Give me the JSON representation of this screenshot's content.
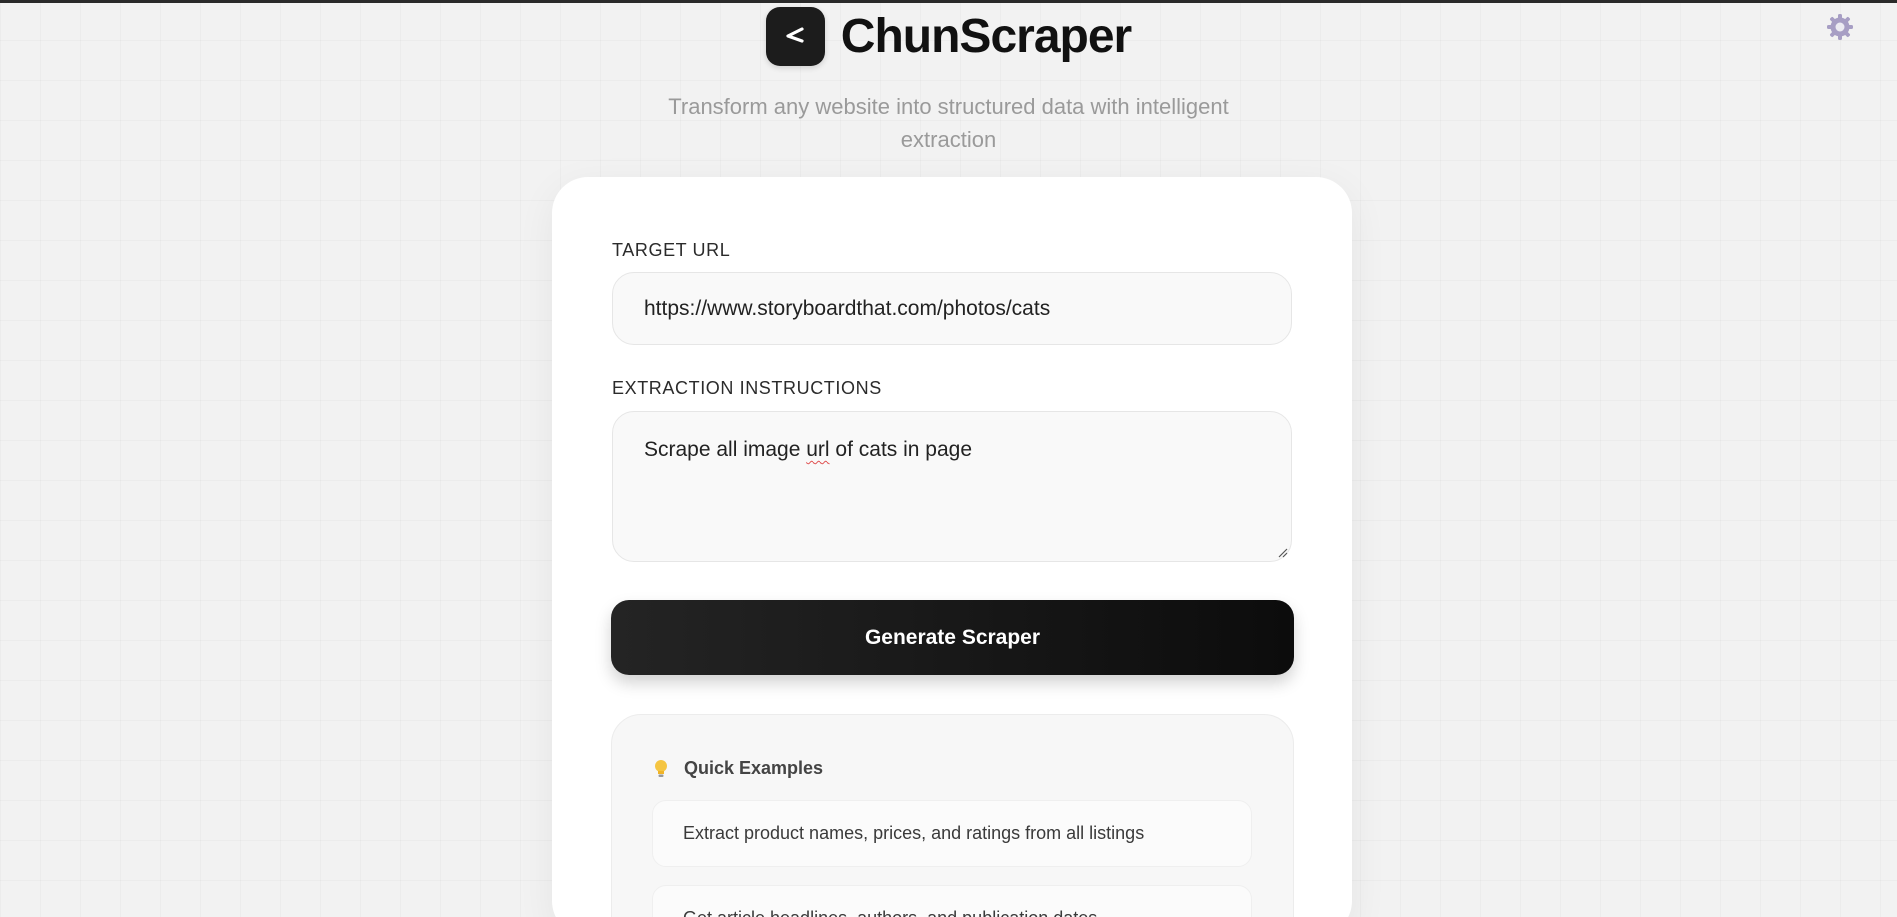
{
  "app": {
    "title": "ChunScraper",
    "subtitle": "Transform any website into structured data with intelligent extraction"
  },
  "icons": {
    "logo": "chevron-left-icon",
    "settings": "gear-icon",
    "examples": "lightbulb-icon"
  },
  "colors": {
    "background": "#f2f2f2",
    "card": "#ffffff",
    "button": "#1a1a1a",
    "button_text": "#ffffff",
    "settings_icon": "#9c93b8",
    "spellcheck": "#e05252"
  },
  "form": {
    "url_label": "TARGET URL",
    "url_value": "https://www.storyboardthat.com/photos/cats",
    "instructions_label": "EXTRACTION INSTRUCTIONS",
    "instructions_value": {
      "before": "Scrape all image ",
      "misspelled": "url",
      "after": " of cats in page"
    },
    "submit_label": "Generate Scraper"
  },
  "examples": {
    "heading": "Quick Examples",
    "items": [
      "Extract product names, prices, and ratings from all listings",
      "Get article headlines, authors, and publication dates"
    ]
  }
}
